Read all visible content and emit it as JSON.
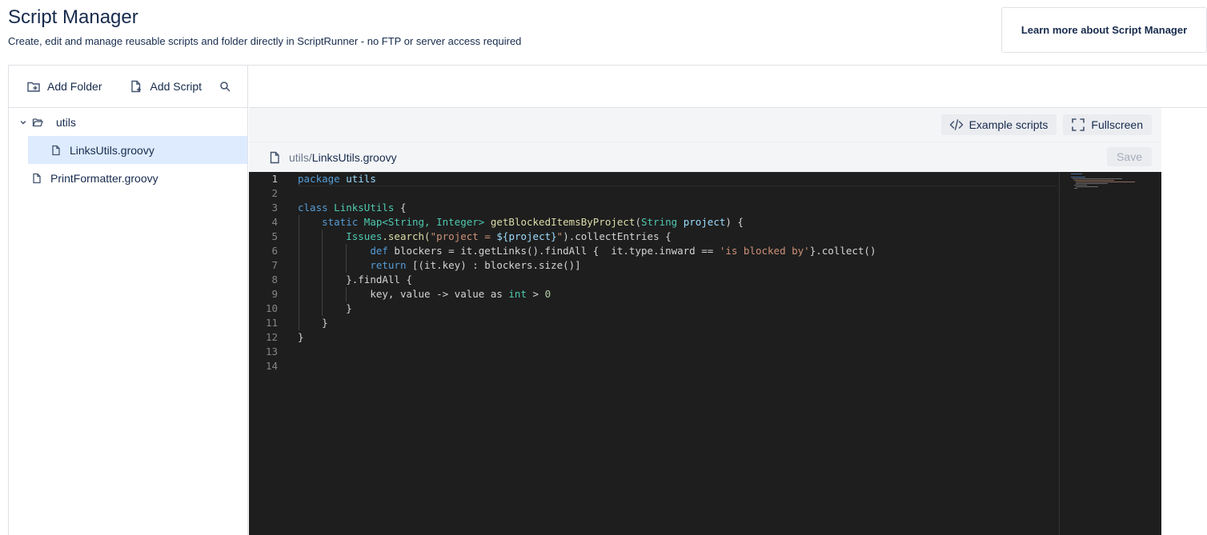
{
  "header": {
    "title": "Script Manager",
    "subtitle": "Create, edit and manage reusable scripts and folder directly in ScriptRunner - no FTP or server access required",
    "learn_more_label": "Learn more about Script Manager"
  },
  "sidebar": {
    "add_folder_label": "Add Folder",
    "add_script_label": "Add Script",
    "tree": {
      "folder_name": "utils",
      "selected_file": "LinksUtils.groovy",
      "root_file": "PrintFormatter.groovy"
    }
  },
  "editor": {
    "example_scripts_label": "Example scripts",
    "fullscreen_label": "Fullscreen",
    "path_dir": "utils",
    "path_sep": "/",
    "path_file": "LinksUtils.groovy",
    "save_label": "Save",
    "line_numbers": [
      "1",
      "2",
      "3",
      "4",
      "5",
      "6",
      "7",
      "8",
      "9",
      "10",
      "11",
      "12",
      "13",
      "14"
    ],
    "code": {
      "l1_kw": "package",
      "l1_name": "utils",
      "l3_kw": "class",
      "l3_name": "LinksUtils",
      "l3_rest": " {",
      "l4_kw": "static",
      "l4_type": "Map<String, Integer>",
      "l4_fn": "getBlockedItemsByProject",
      "l4_p1": "(",
      "l4_ptype": "String",
      "l4_param": "project",
      "l4_rest": ") {",
      "l5_obj": "Issues",
      "l5_a": ".search(",
      "l5_str1": "\"project = ",
      "l5_interp": "${project}",
      "l5_str2": "\"",
      "l5_b": ").collectEntries {",
      "l6_kw": "def",
      "l6_a": " blockers = it.getLinks().findAll {  it.type.inward == ",
      "l6_str": "'is blocked by'",
      "l6_b": "}.collect()",
      "l7_kw": "return",
      "l7_rest": " [(it.key) : blockers.size()]",
      "l8": "}.findAll {",
      "l9_a": "key, value -> value as ",
      "l9_type": "int",
      "l9_b": " > ",
      "l9_num": "0",
      "l10": "}",
      "l11": "}",
      "l12": "}"
    }
  },
  "colors": {
    "editor_bg": "#1e1e1e",
    "keyword": "#569cd6",
    "type": "#4ec9b0",
    "function": "#dcdcaa",
    "string": "#ce9178",
    "number": "#b5cea8",
    "selected_row": "#deebff"
  },
  "icons": {
    "add_folder": "folder-plus-icon",
    "add_script": "file-plus-icon",
    "search": "search-icon",
    "chevron": "chevron-down-icon",
    "folder": "folder-open-icon",
    "file": "file-icon",
    "code": "code-icon",
    "fullscreen": "fullscreen-icon"
  }
}
